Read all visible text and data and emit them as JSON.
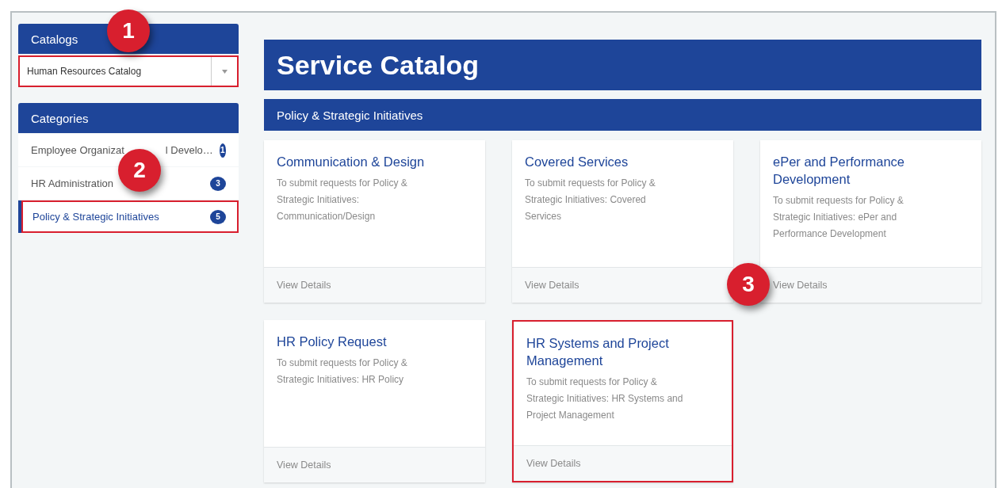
{
  "sidebar": {
    "catalogs": {
      "title": "Catalogs",
      "dropdown": {
        "value": "Human Resources Catalog",
        "highlighted": true
      },
      "callout": "1"
    },
    "categories": {
      "title": "Categories",
      "callout": "2",
      "items": [
        {
          "label": "Employee Organizat",
          "label_tail": "l Develo…",
          "count": "1",
          "selected": false,
          "highlighted": false
        },
        {
          "label": "HR Administration",
          "count": "3",
          "selected": false,
          "highlighted": false
        },
        {
          "label": "Policy & Strategic Initiatives",
          "count": "5",
          "selected": true,
          "highlighted": true
        }
      ]
    }
  },
  "main": {
    "title": "Service Catalog",
    "section": "Policy & Strategic Initiatives",
    "callout": "3",
    "cards": [
      {
        "title": "Communication & Design",
        "description": "To submit requests for Policy & Strategic Initiatives: Communication/Design",
        "link": "View Details",
        "highlighted": false
      },
      {
        "title": "Covered Services",
        "description": "To submit requests for Policy & Strategic Initiatives: Covered Services",
        "link": "View Details",
        "highlighted": false
      },
      {
        "title": "ePer and Performance Development",
        "description": "To submit requests for Policy & Strategic Initiatives: ePer and Performance Development",
        "link": "View Details",
        "highlighted": false
      },
      {
        "title": "HR Policy Request",
        "description": "To submit requests for Policy & Strategic Initiatives: HR Policy",
        "link": "View Details",
        "highlighted": false
      },
      {
        "title": "HR Systems and Project Management",
        "description": "To submit requests for Policy & Strategic Initiatives: HR Systems and Project Management",
        "link": "View Details",
        "highlighted": true
      }
    ]
  }
}
